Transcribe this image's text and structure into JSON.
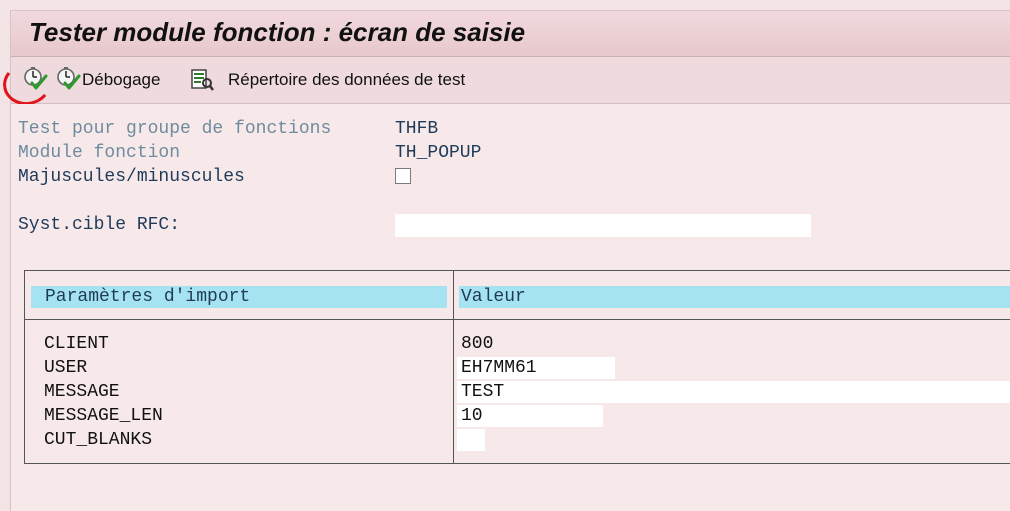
{
  "window": {
    "title": "Tester module fonction : écran de saisie"
  },
  "toolbar": {
    "execute_icon": "execute-clock-check-icon",
    "debug_label": "Débogage",
    "debug_icon": "debug-clock-check-icon",
    "test_dir_label": "Répertoire des données de test",
    "test_dir_icon": "test-data-directory-icon",
    "annotation_color": "#e0141c"
  },
  "fields": {
    "group_label": "Test pour groupe de fonctions",
    "group_value": "THFB",
    "module_label": "Module fonction",
    "module_value": "TH_POPUP",
    "case_label": "Majuscules/minuscules",
    "case_checked": false,
    "rfc_label": "Syst.cible RFC:",
    "rfc_value": ""
  },
  "params_table": {
    "col_param": "Paramètres d'import",
    "col_value": "Valeur",
    "header_color": "#a6e3f0",
    "rows": [
      {
        "name": "CLIENT",
        "value": "800"
      },
      {
        "name": "USER",
        "value": "EH7MM61"
      },
      {
        "name": "MESSAGE",
        "value": "TEST"
      },
      {
        "name": "MESSAGE_LEN",
        "value": "10"
      },
      {
        "name": "CUT_BLANKS",
        "value": ""
      }
    ]
  }
}
